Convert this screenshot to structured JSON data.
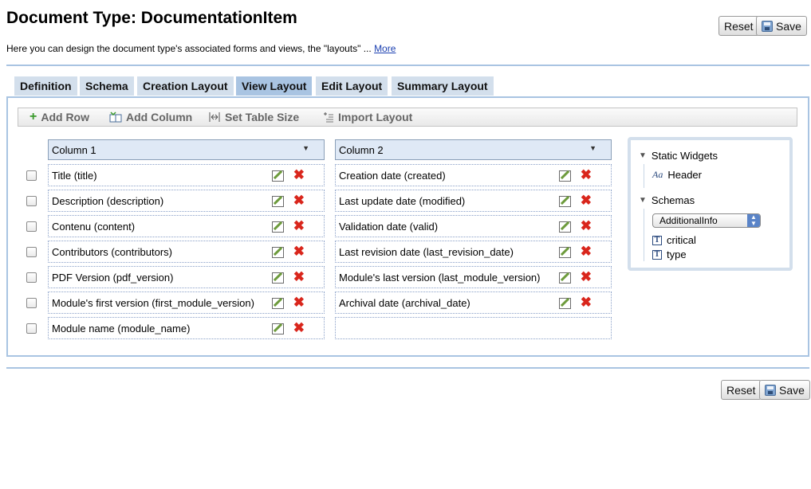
{
  "header": {
    "title": "Document Type: DocumentationItem",
    "intro": "Here you can design the document type's associated forms and views, the \"layouts\" ...",
    "more_link": "More",
    "reset_label": "Reset",
    "save_label": "Save"
  },
  "tabs": [
    {
      "label": "Definition",
      "active": false
    },
    {
      "label": "Schema",
      "active": false
    },
    {
      "label": "Creation Layout",
      "active": false
    },
    {
      "label": "View Layout",
      "active": true
    },
    {
      "label": "Edit Layout",
      "active": false
    },
    {
      "label": "Summary Layout",
      "active": false
    }
  ],
  "toolbar": {
    "add_row": "Add Row",
    "add_column": "Add Column",
    "set_table_size": "Set Table Size",
    "import_layout": "Import Layout"
  },
  "columns": [
    {
      "header": "Column 1",
      "cells": [
        "Title (title)",
        "Description (description)",
        "Contenu (content)",
        "Contributors (contributors)",
        "PDF Version (pdf_version)",
        "Module's first version (first_module_version)",
        "Module name (module_name)"
      ]
    },
    {
      "header": "Column 2",
      "cells": [
        "Creation date (created)",
        "Last update date (modified)",
        "Validation date (valid)",
        "Last revision date (last_revision_date)",
        "Module's last version (last_module_version)",
        "Archival date (archival_date)",
        ""
      ]
    }
  ],
  "sidebar": {
    "static_widgets_label": "Static Widgets",
    "widget_header": "Header",
    "schemas_label": "Schemas",
    "schema_select_value": "AdditionalInfo",
    "fields": [
      "critical",
      "type"
    ]
  },
  "footer": {
    "reset_label": "Reset",
    "save_label": "Save"
  },
  "colors": {
    "tab_active": "#a9c4e2",
    "tab_inactive": "#d3dfec",
    "delete_red": "#d9261c",
    "link_blue": "#1a3fb0"
  }
}
